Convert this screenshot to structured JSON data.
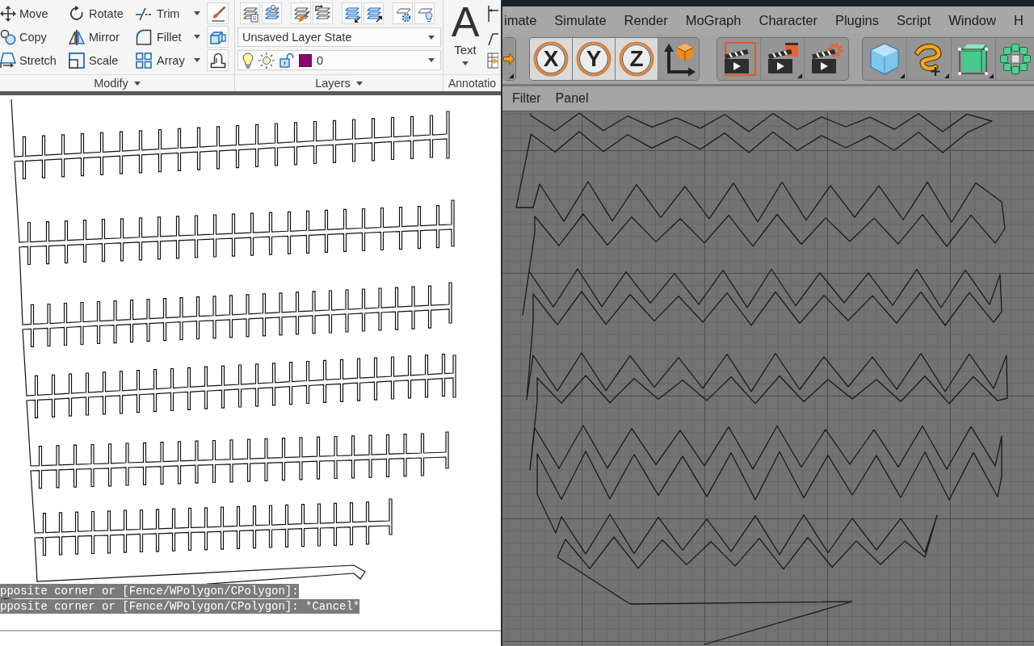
{
  "autocad": {
    "ribbon": {
      "panels": [
        {
          "kind": "modify",
          "title": "Modify",
          "title_caret": true,
          "tools": [
            {
              "label": "Move",
              "dropdown": false
            },
            {
              "label": "Rotate",
              "dropdown": false
            },
            {
              "label": "Trim",
              "dropdown": true
            },
            {
              "label": "Copy",
              "dropdown": false
            },
            {
              "label": "Mirror",
              "dropdown": false
            },
            {
              "label": "Fillet",
              "dropdown": true
            },
            {
              "label": "Stretch",
              "dropdown": false
            },
            {
              "label": "Scale",
              "dropdown": false
            },
            {
              "label": "Array",
              "dropdown": true
            }
          ]
        },
        {
          "kind": "layers",
          "title": "Layers",
          "title_caret": true,
          "layer_state": "Unsaved Layer State",
          "current_layer": {
            "name": "0",
            "color": "#930070"
          }
        },
        {
          "kind": "annotation",
          "title": "Annotatio",
          "title_caret": false,
          "big_tool": {
            "glyph": "A",
            "label": "Text",
            "dropdown": true
          }
        }
      ]
    },
    "command_lines": [
      "pposite corner or [Fence/WPolygon/CPolygon]:",
      "pposite corner or [Fence/WPolygon/CPolygon]: *Cancel*"
    ]
  },
  "cinema4d": {
    "menu": [
      "imate",
      "Simulate",
      "Render",
      "MoGraph",
      "Character",
      "Plugins",
      "Script",
      "Window",
      "H"
    ],
    "toolbar": {
      "groups": [
        {
          "kind": "tools",
          "buttons": [
            {
              "kind": "icon",
              "flyout": true
            }
          ]
        },
        {
          "kind": "axes",
          "buttons": [
            {
              "kind": "axis",
              "label": "X",
              "on": true,
              "flyout": false
            },
            {
              "kind": "axis",
              "label": "Y",
              "on": true,
              "flyout": false
            },
            {
              "kind": "axis",
              "label": "Z",
              "on": true,
              "flyout": false
            },
            {
              "kind": "icon",
              "flyout": false
            }
          ]
        },
        {
          "kind": "render",
          "buttons": [
            {
              "kind": "icon",
              "flyout": false
            },
            {
              "kind": "icon",
              "flyout": true
            },
            {
              "kind": "icon",
              "flyout": false
            }
          ]
        },
        {
          "kind": "objects",
          "buttons": [
            {
              "kind": "icon",
              "flyout": true
            },
            {
              "kind": "icon",
              "flyout": true
            },
            {
              "kind": "icon",
              "flyout": true
            },
            {
              "kind": "icon",
              "flyout": false
            }
          ]
        }
      ]
    },
    "panel_menu": [
      "Filter",
      "Panel"
    ]
  }
}
